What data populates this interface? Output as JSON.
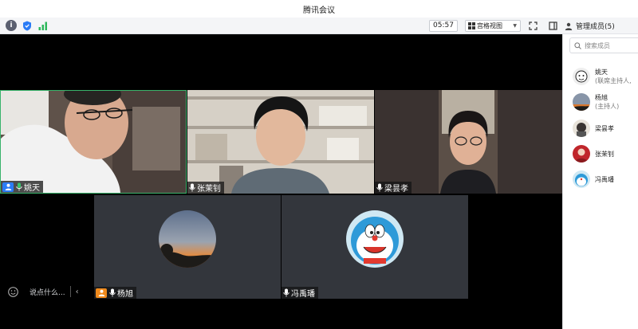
{
  "window": {
    "title": "腾讯会议"
  },
  "toolbar": {
    "timer": "05:57",
    "view_label": "宫格视图",
    "members_label": "管理成员(5)"
  },
  "tiles": [
    {
      "name": "姚天",
      "role": "host"
    },
    {
      "name": "张茉钊"
    },
    {
      "name": "梁昙孝"
    },
    {
      "name": "杨旭",
      "role": "cohost"
    },
    {
      "name": "冯禹璠"
    }
  ],
  "chat": {
    "placeholder": "说点什么..."
  },
  "members": {
    "search_placeholder": "搜索成员",
    "list": [
      {
        "name": "姚天",
        "sub": "(联席主持人,"
      },
      {
        "name": "杨旭",
        "sub": "(主持人)"
      },
      {
        "name": "梁昙孝"
      },
      {
        "name": "张茉钊"
      },
      {
        "name": "冯禹璠"
      }
    ]
  },
  "colors": {
    "accent": "#2b7cf6",
    "active_speaker_border": "#39b36b",
    "cohost_badge": "#f08a1c"
  }
}
